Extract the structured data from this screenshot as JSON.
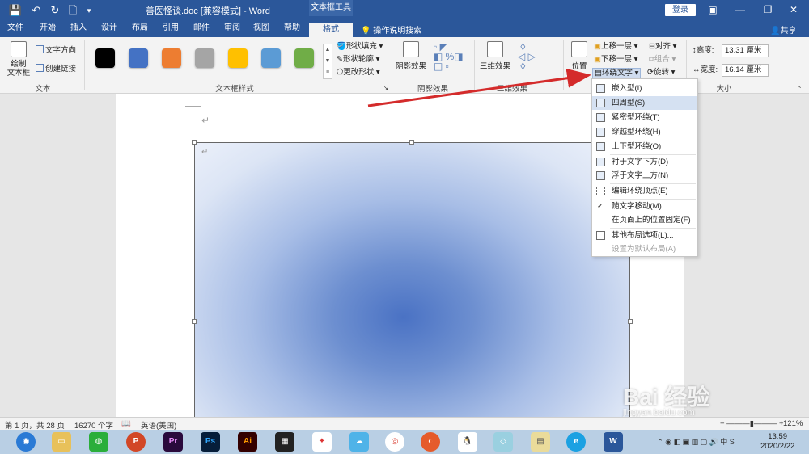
{
  "window": {
    "title": "善医怪谈.doc [兼容模式] - Word",
    "context_group": "文本框工具",
    "login": "登录",
    "share": "共享",
    "tell_me": "操作说明搜索"
  },
  "tabs": [
    "文件",
    "开始",
    "插入",
    "设计",
    "布局",
    "引用",
    "邮件",
    "审阅",
    "视图",
    "帮助",
    "格式"
  ],
  "active_tab": "格式",
  "ribbon": {
    "text_group": {
      "draw_textbox": "绘制\n文本框",
      "text_direction": "文字方向",
      "create_link": "创建链接",
      "label": "文本"
    },
    "textbox_styles": {
      "label": "文本框样式",
      "swatches": [
        "#000000",
        "#4472c4",
        "#ed7d31",
        "#a5a5a5",
        "#ffc000",
        "#5b9bd5",
        "#70ad47"
      ],
      "shape_fill": "形状填充",
      "shape_outline": "形状轮廓",
      "change_shape": "更改形状"
    },
    "shadow": {
      "btn": "阴影效果",
      "label": "阴影效果"
    },
    "threed": {
      "btn": "三维效果",
      "label": "三维效果"
    },
    "arrange": {
      "position": "位置",
      "bring_forward": "上移一层",
      "send_backward": "下移一层",
      "wrap_text": "环绕文字",
      "align": "对齐",
      "group": "组合",
      "rotate": "旋转"
    },
    "size": {
      "label": "大小",
      "height_label": "高度:",
      "height_value": "13.31 厘米",
      "width_label": "宽度:",
      "width_value": "16.14 厘米"
    }
  },
  "wrap_menu": {
    "items": [
      {
        "label": "嵌入型(I)",
        "enabled": true
      },
      {
        "label": "四周型(S)",
        "enabled": true
      },
      {
        "label": "紧密型环绕(T)",
        "enabled": true
      },
      {
        "label": "穿越型环绕(H)",
        "enabled": true
      },
      {
        "label": "上下型环绕(O)",
        "enabled": true
      },
      {
        "label": "衬于文字下方(D)",
        "enabled": true
      },
      {
        "label": "浮于文字上方(N)",
        "enabled": true
      },
      {
        "label": "编辑环绕顶点(E)",
        "enabled": true
      },
      {
        "label": "随文字移动(M)",
        "enabled": true,
        "checked": true
      },
      {
        "label": "在页面上的位置固定(F)",
        "enabled": true
      },
      {
        "label": "其他布局选项(L)...",
        "enabled": true
      },
      {
        "label": "设置为默认布局(A)",
        "enabled": false
      }
    ]
  },
  "statusbar": {
    "page": "第 1 页，共 28 页",
    "words": "16270 个字",
    "language": "英语(美国)",
    "zoom": "121%"
  },
  "taskbar": {
    "apps": [
      "Pr",
      "Ps",
      "Ai",
      "W"
    ],
    "time": "13:59",
    "date": "2020/2/22"
  },
  "watermark": {
    "brand": "Bai 经验",
    "url": "jingyan.baidu.com"
  }
}
